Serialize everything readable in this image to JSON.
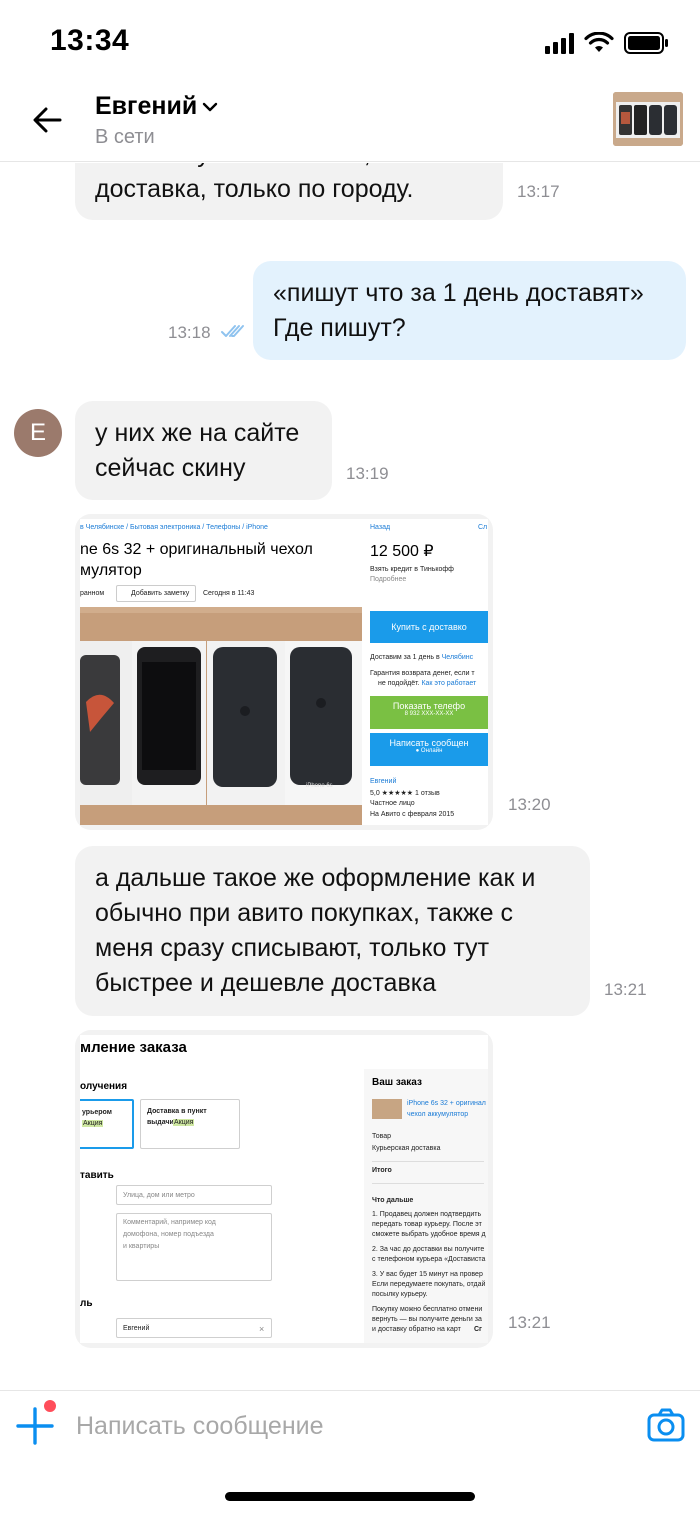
{
  "status_bar": {
    "time": "13:34"
  },
  "header": {
    "name": "Евгений",
    "status": "В сети"
  },
  "messages": [
    {
      "dir": "in",
      "text": "это всё тут не на авито, ничё\nдоставка, только по городу.",
      "time": "13:17"
    },
    {
      "dir": "out",
      "text": "«пишут что за 1 день доставят»\nГде пишут?",
      "time": "13:18",
      "read": true
    },
    {
      "dir": "in",
      "text": "у них же на сайте\nсейчас скину",
      "time": "13:19",
      "avatar_letter": "Е"
    },
    {
      "dir": "in",
      "type": "image",
      "time": "13:20"
    },
    {
      "dir": "in",
      "text": "а дальше такое же оформление как и\nобычно при авито покупках, также с\nменя сразу списывают, только тут\nбыстрее и дешевле доставка",
      "time": "13:21"
    },
    {
      "dir": "in",
      "type": "image",
      "time": "13:21"
    }
  ],
  "screenshot1": {
    "breadcrumb": "в Челябинске / Бытовая электроника / Телефоны / iPhone",
    "title_line1": "ne 6s 32 + оригинальный чехол",
    "title_line2": "мулятор",
    "meta_fav": "ранном",
    "meta_note": "Добавить заметку",
    "meta_date": "Сегодня в 11:43",
    "back": "Назад",
    "back_right": "Сл",
    "price": "12 500 ₽",
    "credit": "Взять кредит в Тинькофф",
    "credit_more": "Подробнее",
    "buy_btn": "Купить с доставко",
    "delivery_prefix": "Доставим за 1 день в",
    "delivery_city": "Челябинс",
    "guarantee1": "Гарантия возврата денег, если т",
    "guarantee2": "не подойдёт.",
    "guarantee_link": "Как это работает",
    "phone_btn": "Показать телефо",
    "phone_mask": "8 932 XXX-XX-XX",
    "write_btn": "Написать сообщен",
    "online": "● Онлайн",
    "seller": "Евгений",
    "rating": "5,0 ★★★★★  1 отзыв",
    "seller_type": "Частное лицо",
    "since": "На Авито с февраля 2015",
    "phone_label": "iPhone 6s"
  },
  "screenshot2": {
    "title": "мление заказа",
    "section_receive": "олучения",
    "opt_courier": "урьером",
    "opt_pickup": "Доставка в пункт",
    "opt_pickup2": "выдачи",
    "badge": "Акция",
    "section_deliver": "тавить",
    "address_ph": "Улица, дом или метро",
    "comment_ph1": "Комментарий, например код",
    "comment_ph2": "домофона, номер подъезда",
    "comment_ph3": "и квартиры",
    "section_name": "ль",
    "name_value": "Евгений",
    "your_order": "Ваш заказ",
    "order_item1": "iPhone 6s 32 + оригинал",
    "order_item2": "чехол аккумулятор",
    "row_item": "Товар",
    "row_delivery": "Курьерская доставка",
    "row_total": "Итого",
    "next_title": "Что дальше",
    "next1a": "1. Продавец должен подтвердить",
    "next1b": "передать товар курьеру. После эт",
    "next1c": "сможете выбрать удобное время д",
    "next2a": "2. За час до доставки вы получите",
    "next2b": "с телефоном курьера «Достависта",
    "next3a": "3. У вас будет 15 минут на провер",
    "next3b": "Если передумаете покупать, отдай",
    "next3c": "посылку курьеру.",
    "next4a": "Покупку можно бесплатно отмени",
    "next4b": "вернуть — вы получите деньги за",
    "next4c": "и доставку обратно на карт",
    "corner": "Сг"
  },
  "input": {
    "placeholder": "Написать сообщение"
  },
  "colors": {
    "accent": "#0a8ef0",
    "out_bubble": "#e3f2fd",
    "in_bubble": "#f2f2f2",
    "badge_dot": "#ff4d5a"
  }
}
